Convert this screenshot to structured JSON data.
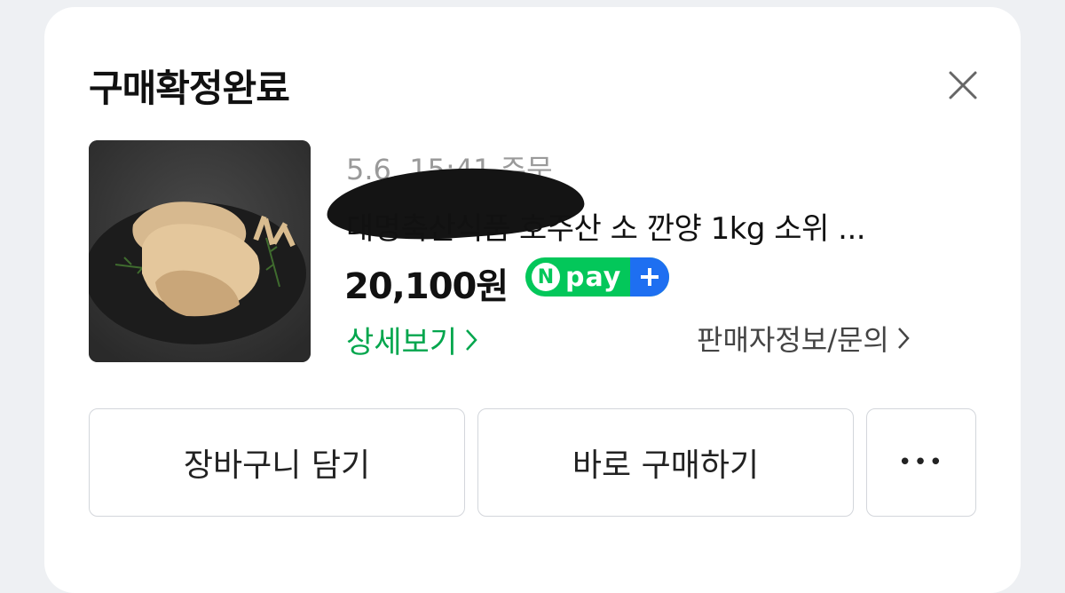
{
  "dialog": {
    "title": "구매확정완료"
  },
  "order": {
    "date_label": "5.6. 15:41 주문",
    "product_name": "대명축산식품 호주산 소 깐양 1kg 소위 ...",
    "price": "20,100원",
    "npay_badge": {
      "n": "N",
      "text": "pay",
      "colors": {
        "green": "#03c75a",
        "blue": "#1e6ff1"
      }
    },
    "detail_link": "상세보기",
    "seller_link": "판매자정보/문의"
  },
  "actions": {
    "cart_label": "장바구니 담기",
    "buy_label": "바로 구매하기",
    "more_label": "•••"
  },
  "icons": [
    "close-icon",
    "chevron-right-icon",
    "npay-plus-icon",
    "more-icon"
  ],
  "colors": {
    "accent_green": "#03a64d",
    "date_gray": "#9a9a9a"
  }
}
